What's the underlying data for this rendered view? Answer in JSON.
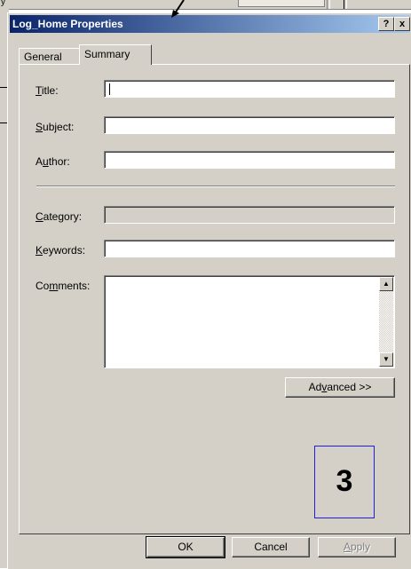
{
  "background": {
    "fragment_char": "y"
  },
  "dialog": {
    "title": "Log_Home Properties",
    "help_button": "?",
    "close_button": "x",
    "tabs": [
      {
        "label": "General",
        "active": false
      },
      {
        "label": "Summary",
        "active": true
      }
    ],
    "fields": {
      "title": {
        "label": "Title:",
        "accel": "T",
        "rest": "itle:",
        "value": ""
      },
      "subject": {
        "label": "Subject:",
        "accel": "S",
        "rest": "ubject:",
        "value": ""
      },
      "author": {
        "label": "Author:",
        "pre": "A",
        "accel": "u",
        "rest": "thor:",
        "value": ""
      },
      "category": {
        "label": "Category:",
        "accel": "C",
        "rest": "ategory:",
        "value": "",
        "disabled": true
      },
      "keywords": {
        "label": "Keywords:",
        "accel": "K",
        "rest": "eywords:",
        "value": ""
      },
      "comments": {
        "label": "Comments:",
        "pre": "Co",
        "accel": "m",
        "rest": "ments:",
        "value": ""
      }
    },
    "advanced_button": {
      "pre": "Ad",
      "accel": "v",
      "rest": "anced >>"
    },
    "ok_button": "OK",
    "cancel_button": "Cancel",
    "apply_button": {
      "accel": "A",
      "rest": "pply",
      "disabled": true
    }
  },
  "annotation": {
    "step_number": "3",
    "border_color": "#1f1fe0"
  },
  "colors": {
    "title_gradient_start": "#0a246a",
    "title_gradient_end": "#a6caf0",
    "dialog_bg": "#d4d0c8"
  }
}
